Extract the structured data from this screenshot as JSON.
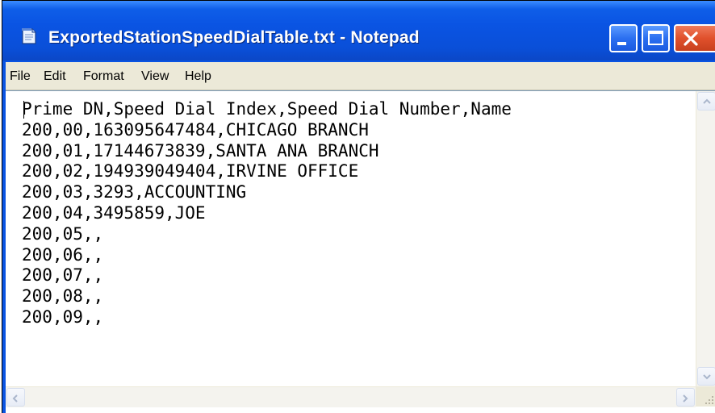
{
  "window": {
    "title": "ExportedStationSpeedDialTable.txt - Notepad",
    "title_color": "#ffffff",
    "titlebar_color": "#0a54e3",
    "close_color": "#e0502c"
  },
  "menu": {
    "items": [
      {
        "label": "File"
      },
      {
        "label": "Edit"
      },
      {
        "label": "Format"
      },
      {
        "label": "View"
      },
      {
        "label": "Help"
      }
    ]
  },
  "document": {
    "lines": [
      "Prime DN,Speed Dial Index,Speed Dial Number,Name",
      "200,00,163095647484,CHICAGO BRANCH",
      "200,01,17144673839,SANTA ANA BRANCH",
      "200,02,194939049404,IRVINE OFFICE",
      "200,03,3293,ACCOUNTING",
      "200,04,3495859,JOE",
      "200,05,,",
      "200,06,,",
      "200,07,,",
      "200,08,,",
      "200,09,,"
    ]
  },
  "icons": {
    "app": "notepad-icon",
    "minimize": "minimize-icon",
    "maximize": "maximize-icon",
    "close": "close-icon",
    "scroll_up": "arrow-up-icon",
    "scroll_down": "arrow-down-icon",
    "scroll_left": "arrow-left-icon",
    "scroll_right": "arrow-right-icon",
    "size_grip": "size-grip-icon"
  }
}
